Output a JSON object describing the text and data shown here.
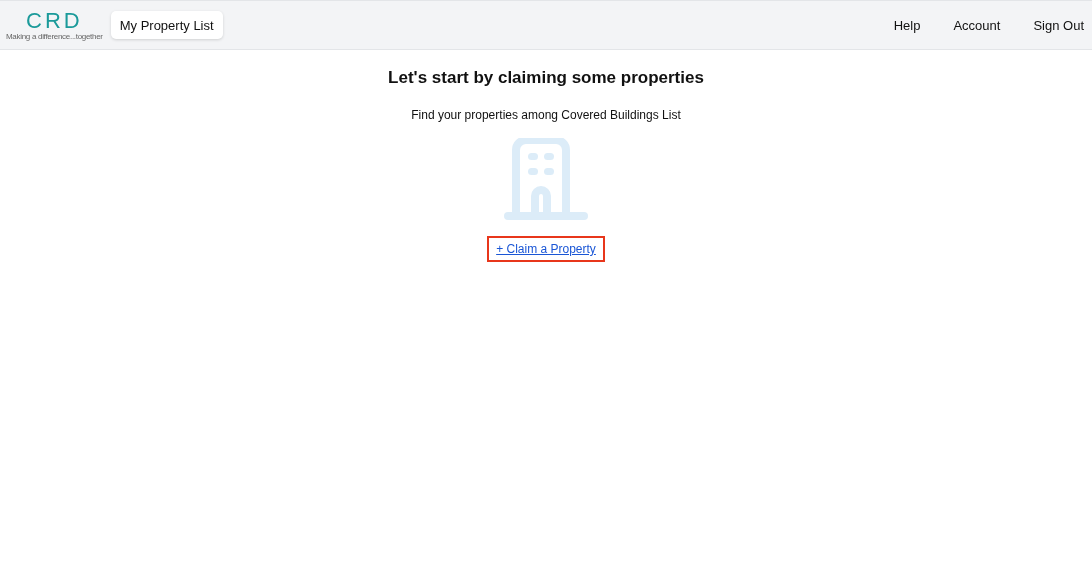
{
  "header": {
    "logo": {
      "mark": "CRD",
      "tagline": "Making a difference...together"
    },
    "nav_button": "My Property List",
    "links": [
      "Help",
      "Account",
      "Sign Out"
    ]
  },
  "main": {
    "title": "Let's start by claiming some properties",
    "subtitle": "Find your properties among Covered Buildings List",
    "action": {
      "label": "+ Claim a Property",
      "highlighted": true
    }
  }
}
